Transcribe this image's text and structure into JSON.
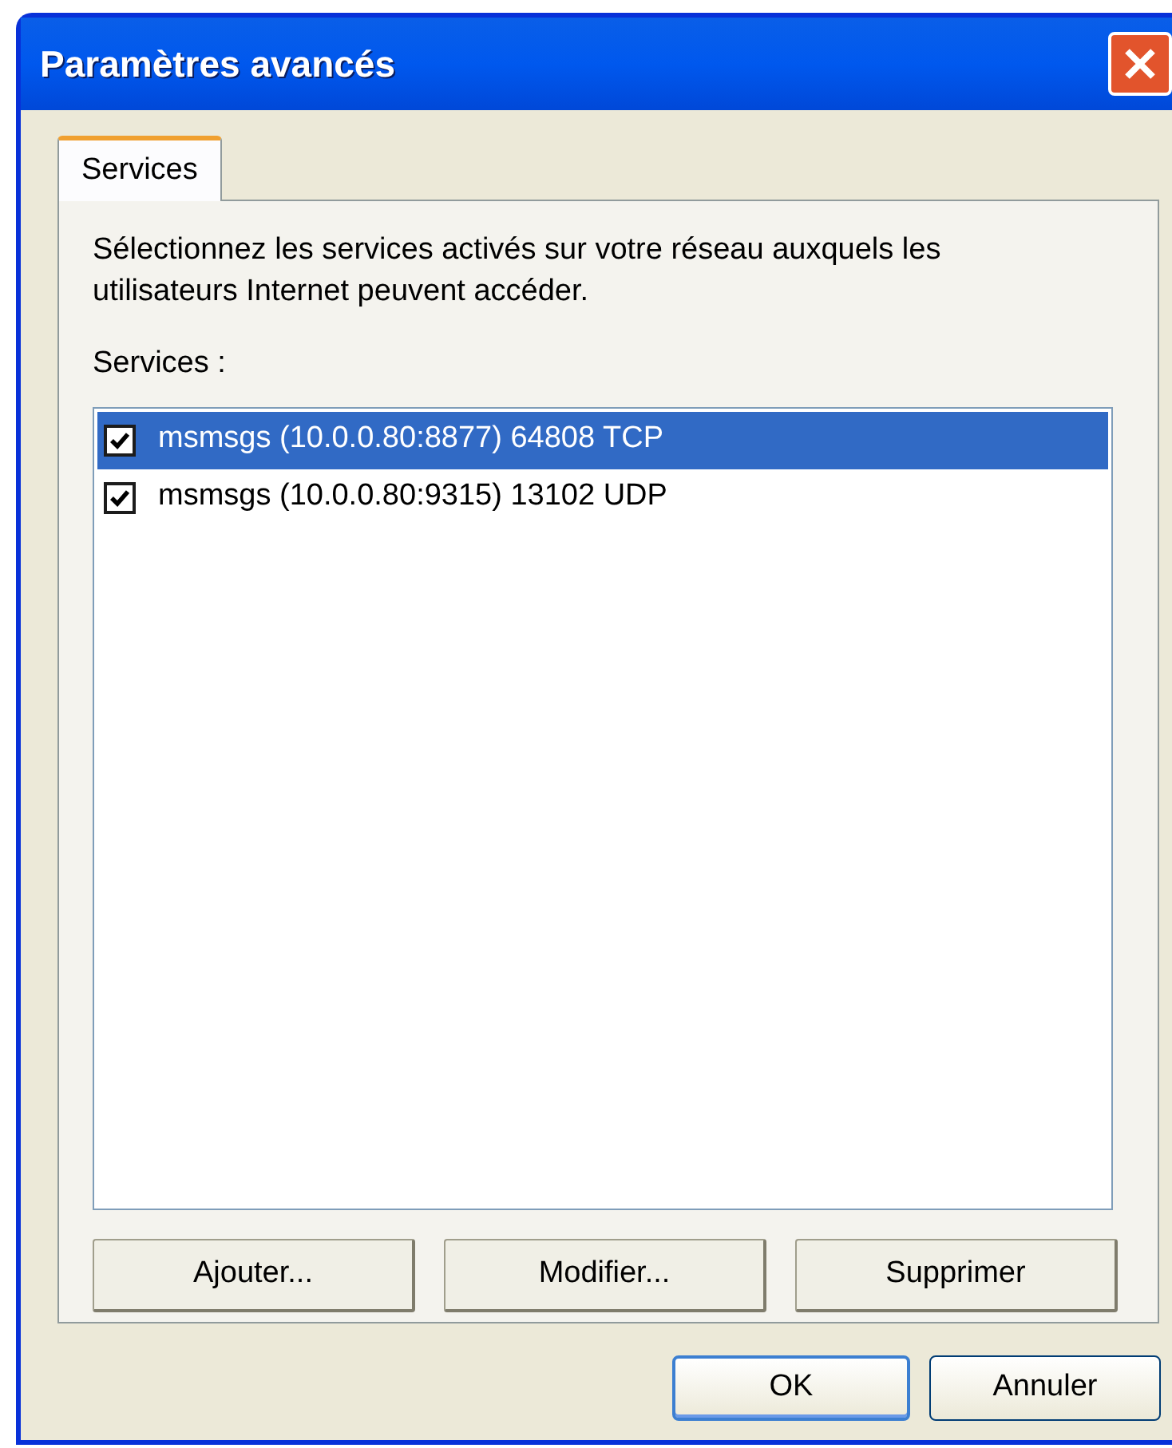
{
  "window": {
    "title": "Paramètres avancés"
  },
  "tabs": [
    {
      "label": "Services",
      "selected": true
    }
  ],
  "description": "Sélectionnez les services activés sur votre réseau auxquels les utilisateurs Internet peuvent accéder.",
  "list_label": "Services :",
  "services": [
    {
      "label": "msmsgs (10.0.0.80:8877) 64808 TCP",
      "checked": true,
      "selected": true
    },
    {
      "label": "msmsgs (10.0.0.80:9315) 13102 UDP",
      "checked": true,
      "selected": false
    }
  ],
  "panel_buttons": [
    "Ajouter...",
    "Modifier...",
    "Supprimer"
  ],
  "dialog_buttons": [
    {
      "label": "OK",
      "default": true
    },
    {
      "label": "Annuler",
      "default": false
    }
  ]
}
